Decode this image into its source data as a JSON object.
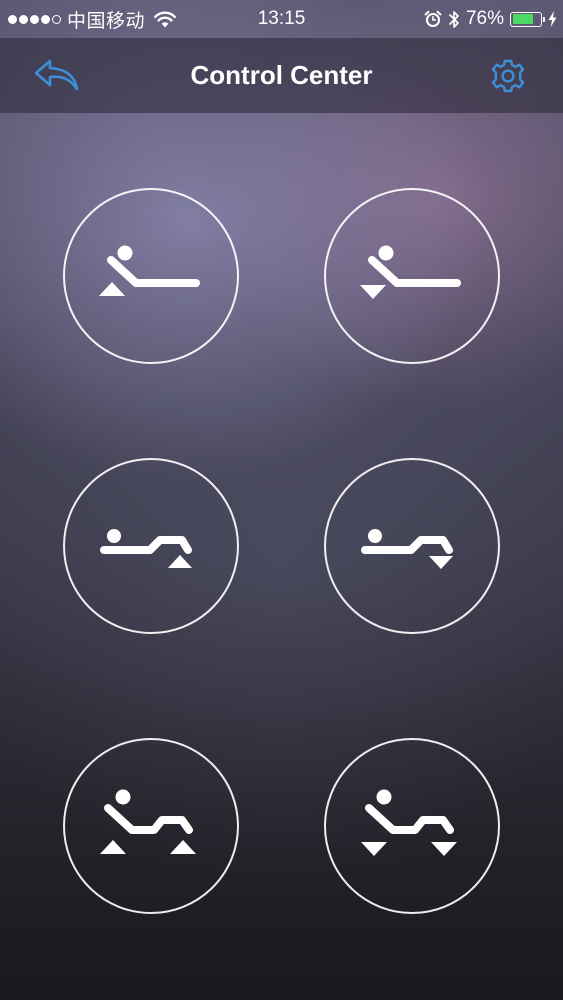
{
  "status_bar": {
    "signal_strength": 4,
    "signal_total": 5,
    "carrier": "中国移动",
    "time": "13:15",
    "battery_percent": "76%",
    "battery_level": 0.76,
    "icons": [
      "wifi-icon",
      "alarm-icon",
      "bluetooth-icon",
      "battery-icon",
      "charging-icon"
    ]
  },
  "nav": {
    "title": "Control Center",
    "back_icon": "back-arrow-icon",
    "settings_icon": "gear-icon",
    "accent_color": "#3f8fd6"
  },
  "controls": [
    {
      "name": "head-raise",
      "icon": "head-raise-icon"
    },
    {
      "name": "head-lower",
      "icon": "head-lower-icon"
    },
    {
      "name": "foot-raise",
      "icon": "foot-raise-icon"
    },
    {
      "name": "foot-lower",
      "icon": "foot-lower-icon"
    },
    {
      "name": "head-foot-raise",
      "icon": "head-foot-raise-icon"
    },
    {
      "name": "head-foot-lower",
      "icon": "head-foot-lower-icon"
    }
  ]
}
